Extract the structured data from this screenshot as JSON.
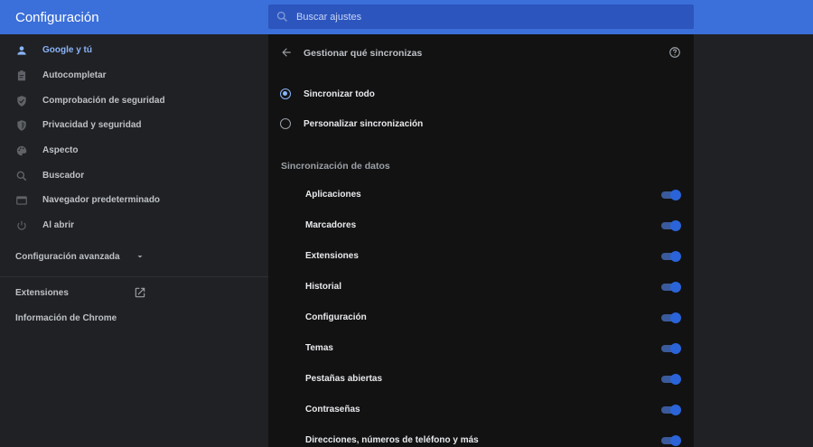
{
  "header": {
    "title": "Configuración",
    "search_placeholder": "Buscar ajustes"
  },
  "sidebar": {
    "items": [
      {
        "label": "Google y tú",
        "icon": "person-icon",
        "active": true
      },
      {
        "label": "Autocompletar",
        "icon": "clipboard-icon"
      },
      {
        "label": "Comprobación de seguridad",
        "icon": "shield-check-icon"
      },
      {
        "label": "Privacidad y seguridad",
        "icon": "shield-icon"
      },
      {
        "label": "Aspecto",
        "icon": "palette-icon"
      },
      {
        "label": "Buscador",
        "icon": "search-icon"
      },
      {
        "label": "Navegador predeterminado",
        "icon": "browser-icon"
      },
      {
        "label": "Al abrir",
        "icon": "power-icon"
      }
    ],
    "advanced_label": "Configuración avanzada",
    "extensions_label": "Extensiones",
    "about_label": "Información de Chrome"
  },
  "main": {
    "title": "Gestionar qué sincronizas",
    "radio_options": [
      {
        "label": "Sincronizar todo",
        "selected": true
      },
      {
        "label": "Personalizar sincronización",
        "selected": false
      }
    ],
    "section_title": "Sincronización de datos",
    "sync_items": [
      {
        "label": "Aplicaciones",
        "enabled": true
      },
      {
        "label": "Marcadores",
        "enabled": true
      },
      {
        "label": "Extensiones",
        "enabled": true
      },
      {
        "label": "Historial",
        "enabled": true
      },
      {
        "label": "Configuración",
        "enabled": true
      },
      {
        "label": "Temas",
        "enabled": true
      },
      {
        "label": "Pestañas abiertas",
        "enabled": true
      },
      {
        "label": "Contraseñas",
        "enabled": true
      },
      {
        "label": "Direcciones, números de teléfono y más",
        "enabled": true
      }
    ]
  },
  "colors": {
    "accent": "#8ab4f8",
    "header_bg": "#3b6fd9",
    "search_bg": "#2c55bd",
    "toggle": "#2a64d8"
  }
}
